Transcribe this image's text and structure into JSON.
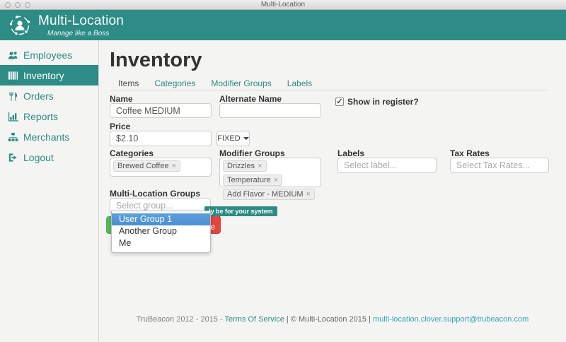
{
  "window": {
    "title": "Multi-Location"
  },
  "header": {
    "app_name": "Multi-Location",
    "tagline": "Manage like a Boss"
  },
  "colors": {
    "accent_teal": "#2d8c85",
    "highlight_blue": "#5094d8",
    "save_green": "#5cb85c",
    "delete_red": "#e2443e"
  },
  "sidebar": {
    "items": [
      {
        "label": "Employees",
        "icon": "users-icon",
        "active": false
      },
      {
        "label": "Inventory",
        "icon": "inventory-icon",
        "active": true
      },
      {
        "label": "Orders",
        "icon": "cutlery-icon",
        "active": false
      },
      {
        "label": "Reports",
        "icon": "bar-chart-icon",
        "active": false
      },
      {
        "label": "Merchants",
        "icon": "sitemap-icon",
        "active": false
      },
      {
        "label": "Logout",
        "icon": "logout-icon",
        "active": false
      }
    ]
  },
  "main": {
    "title": "Inventory",
    "tabs": [
      {
        "label": "Items",
        "active": true
      },
      {
        "label": "Categories",
        "active": false
      },
      {
        "label": "Modifier Groups",
        "active": false
      },
      {
        "label": "Labels",
        "active": false
      }
    ],
    "form": {
      "name": {
        "label": "Name",
        "value": "Coffee MEDIUM"
      },
      "alternate_name": {
        "label": "Alternate Name",
        "value": ""
      },
      "show_in_register": {
        "label": "Show in register?",
        "checked": true
      },
      "price": {
        "label": "Price",
        "value": "$2.10",
        "mode_button": "FIXED"
      },
      "categories": {
        "label": "Categories",
        "tags": [
          "Brewed Coffee"
        ]
      },
      "modifier_groups": {
        "label": "Modifier Groups",
        "tags": [
          "Drizzles",
          "Temperature",
          "Add Flavor - MEDIUM"
        ]
      },
      "labels": {
        "label": "Labels",
        "placeholder": "Select label..."
      },
      "tax_rates": {
        "label": "Tax Rates",
        "placeholder": "Select Tax Rates..."
      },
      "multi_location_groups": {
        "label": "Multi-Location Groups",
        "placeholder": "Select group..."
      }
    },
    "group_dropdown": {
      "options": [
        {
          "label": "User Group 1",
          "highlighted": true
        },
        {
          "label": "Another Group",
          "highlighted": false
        },
        {
          "label": "Me",
          "highlighted": false
        }
      ]
    },
    "obscured": {
      "tooltip_visible_text": "ly be for your system",
      "delete_button_visible_text": "e"
    }
  },
  "footer": {
    "prefix": "TruBeacon 2012 - 2015 - ",
    "terms_link": "Terms Of Service",
    "middle": " | © Multi-Location 2015 | ",
    "email_link": "multi-location.clover.support@trubeacon.com"
  }
}
